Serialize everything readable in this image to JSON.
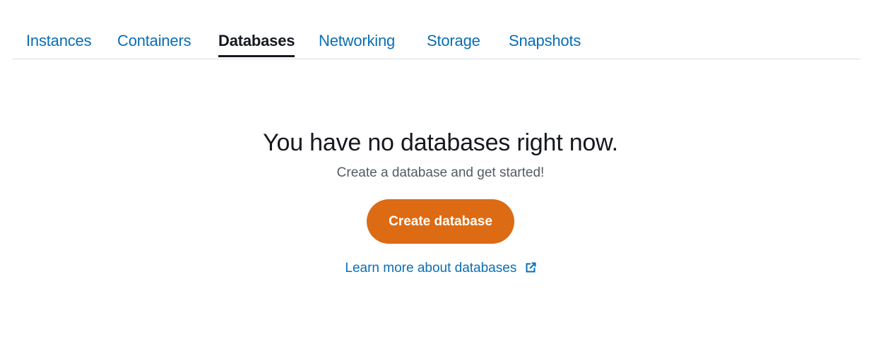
{
  "tabs": [
    {
      "label": "Instances",
      "active": false
    },
    {
      "label": "Containers",
      "active": false
    },
    {
      "label": "Databases",
      "active": true
    },
    {
      "label": "Networking",
      "active": false
    },
    {
      "label": "Storage",
      "active": false
    },
    {
      "label": "Snapshots",
      "active": false
    }
  ],
  "empty_state": {
    "headline": "You have no databases right now.",
    "subtext": "Create a database and get started!",
    "create_button_label": "Create database",
    "learn_more_label": "Learn more about databases",
    "learn_more_icon": "external-link-icon"
  },
  "colors": {
    "link": "#0a6eb4",
    "active_tab": "#16191f",
    "primary_button": "#dc6b14"
  }
}
